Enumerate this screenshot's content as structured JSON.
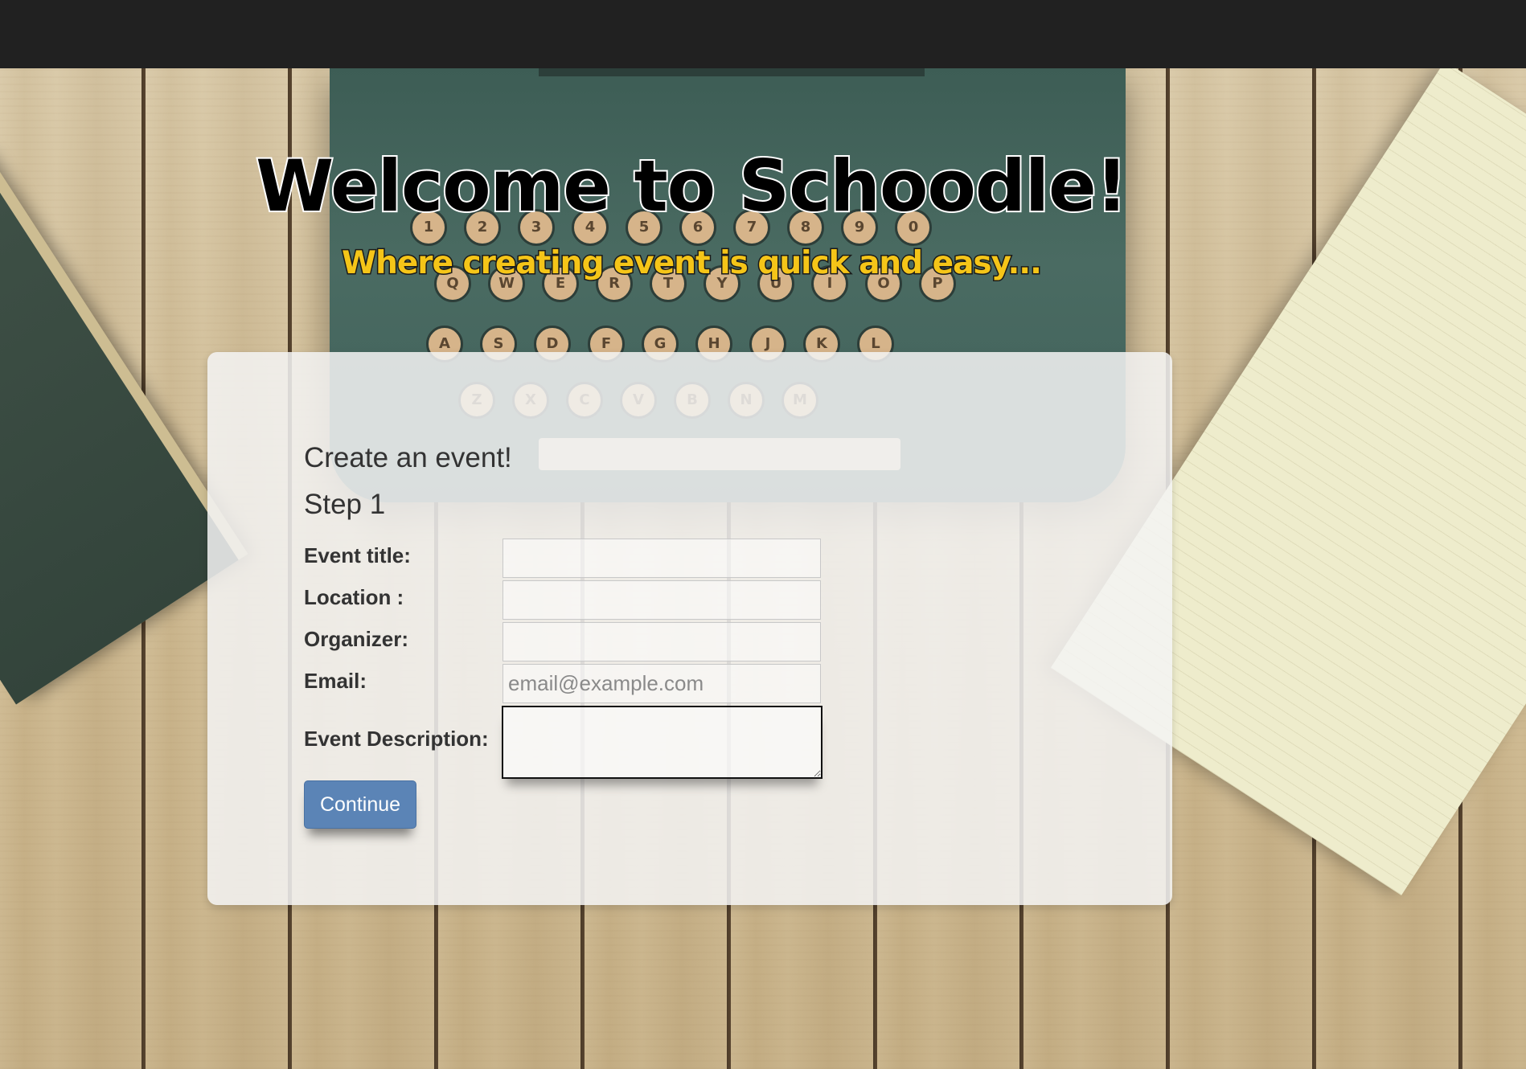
{
  "hero": {
    "title": "Welcome to Schoodle!",
    "subtitle": "Where creating event is quick and easy..."
  },
  "form": {
    "heading": "Create an event!",
    "step": "Step 1",
    "fields": [
      {
        "label": "Event title:",
        "value": "",
        "placeholder": ""
      },
      {
        "label": "Location :",
        "value": "",
        "placeholder": ""
      },
      {
        "label": "Organizer:",
        "value": "",
        "placeholder": ""
      },
      {
        "label": "Email:",
        "value": "",
        "placeholder": "email@example.com"
      }
    ],
    "description_label": "Event Description:",
    "continue_label": "Continue"
  },
  "background": {
    "typewriter_keys": [
      "1",
      "2",
      "3",
      "4",
      "5",
      "6",
      "7",
      "8",
      "9",
      "0",
      "Q",
      "W",
      "E",
      "R",
      "T",
      "Y",
      "U",
      "I",
      "O",
      "P",
      "A",
      "S",
      "D",
      "F",
      "G",
      "H",
      "J",
      "K",
      "L",
      "Z",
      "X",
      "C",
      "V",
      "B",
      "N",
      "M"
    ]
  },
  "colors": {
    "navbar": "#212121",
    "title_fill": "#000000",
    "subtitle_fill": "#f5c518",
    "button": "#5b84b6"
  }
}
